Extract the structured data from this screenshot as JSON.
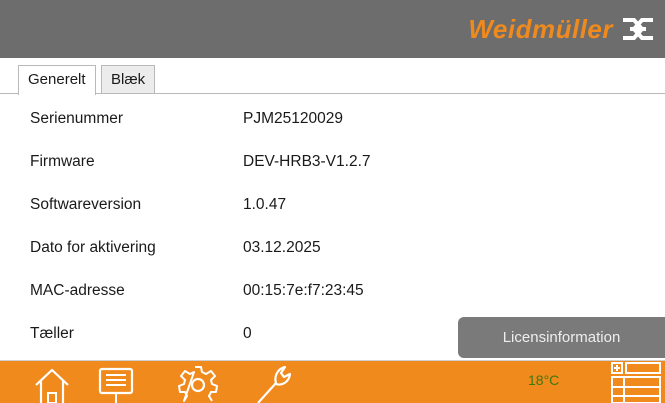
{
  "brand": {
    "name": "Weidmüller",
    "color": "#f08a1c"
  },
  "tabs": [
    {
      "label": "Generelt",
      "active": true
    },
    {
      "label": "Blæk",
      "active": false
    }
  ],
  "info_rows": [
    {
      "label": "Serienummer",
      "value": "PJM25120029"
    },
    {
      "label": "Firmware",
      "value": "DEV-HRB3-V1.2.7"
    },
    {
      "label": "Softwareversion",
      "value": "1.0.47"
    },
    {
      "label": "Dato for aktivering",
      "value": "03.12.2025"
    },
    {
      "label": "MAC-adresse",
      "value": "00:15:7e:f7:23:45"
    },
    {
      "label": "Tæller",
      "value": "0"
    }
  ],
  "license_button": {
    "label": "Licensinformation"
  },
  "bottom_nav": {
    "items": [
      "home-icon",
      "print-jobs-icon",
      "settings-gear-icon",
      "wrench-icon"
    ],
    "temperature": "18°C",
    "menu_icon": "table-menu-icon"
  },
  "colors": {
    "topbar": "#6d6d6d",
    "bottombar": "#f08a1c",
    "button": "#7a7a7a",
    "temperature": "#3a7a12"
  }
}
